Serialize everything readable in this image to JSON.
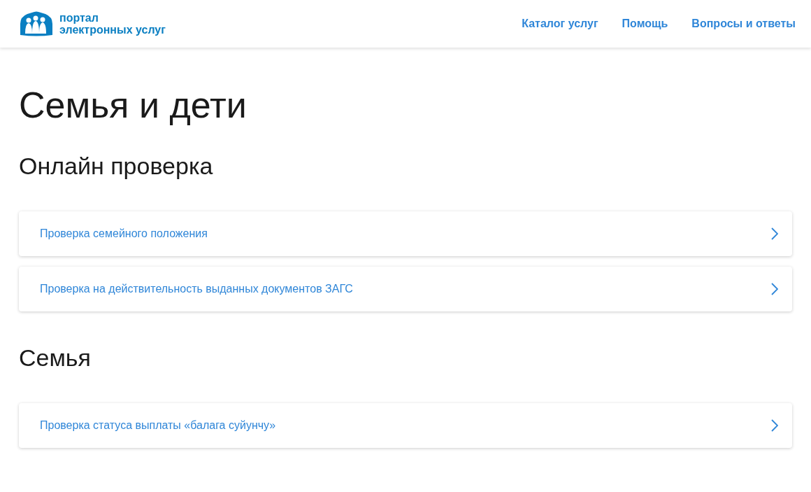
{
  "header": {
    "logo_text": [
      "портал",
      "электронных услуг"
    ],
    "nav": [
      "Каталог услуг",
      "Помощь",
      "Вопросы и ответы"
    ]
  },
  "page_title": "Семья и дети",
  "sections": [
    {
      "title": "Онлайн проверка",
      "items": [
        "Проверка семейного положения",
        "Проверка на действительность выданных документов ЗАГС"
      ]
    },
    {
      "title": "Семья",
      "items": [
        "Проверка статуса выплаты «балага суйунчу»"
      ]
    }
  ]
}
